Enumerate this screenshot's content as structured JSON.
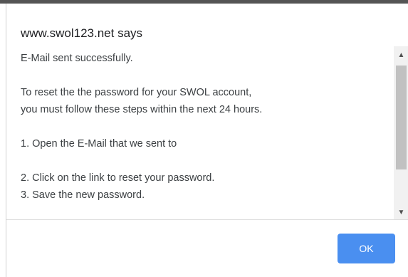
{
  "dialog": {
    "title": "www.swol123.net says",
    "message_lines": [
      "E-Mail sent successfully.",
      "",
      "To reset the the password for your SWOL account,",
      "you must follow these steps within the next 24 hours.",
      "",
      "1. Open the E-Mail that we sent to",
      "",
      "2. Click on the link to reset your password.",
      "3. Save the new password."
    ],
    "ok_label": "OK"
  },
  "scrollbar": {
    "up_icon": "▲",
    "down_icon": "▼"
  },
  "colors": {
    "ok_button": "#4a8ff0",
    "scroll_thumb": "#c1c1c1",
    "top_strip": "#555555"
  }
}
